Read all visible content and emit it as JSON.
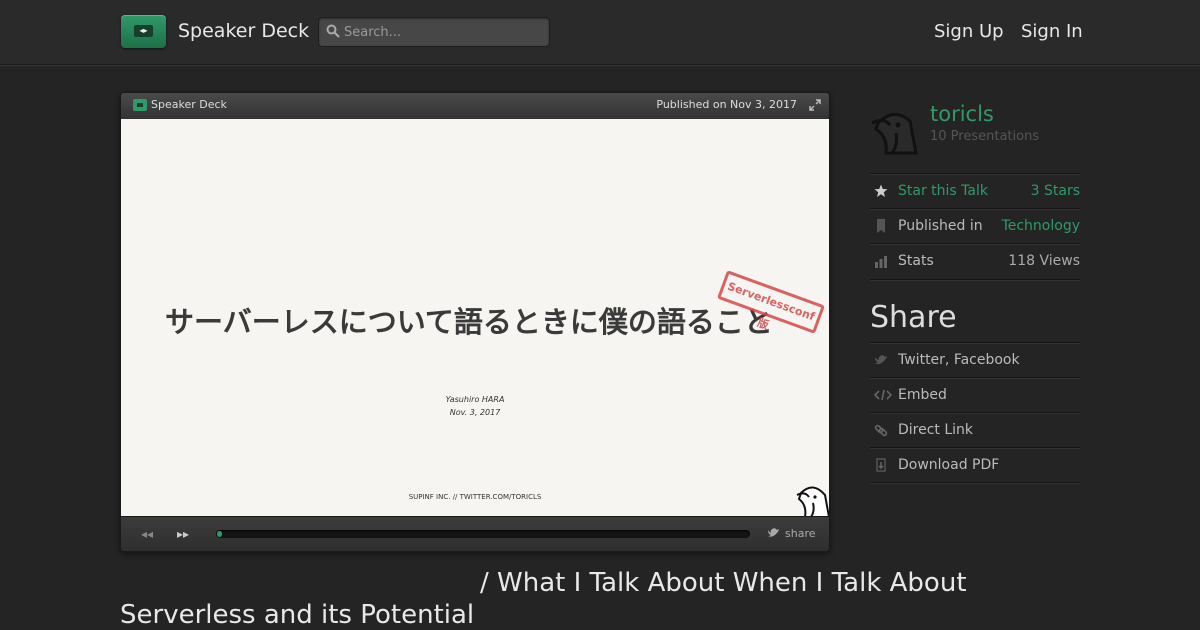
{
  "header": {
    "brand": "Speaker Deck",
    "logo_glyph": "◂▸",
    "search_placeholder": "Search...",
    "sign_up": "Sign Up",
    "sign_in": "Sign In"
  },
  "player": {
    "brand": "Speaker Deck",
    "published": "Published on Nov 3, 2017",
    "slide": {
      "title": "サーバーレスについて語るときに僕の語ること",
      "stamp": "Serverlessconf 版",
      "author": "Yasuhiro HARA",
      "date": "Nov. 3, 2017",
      "footer": "SUPINF INC. // TWITTER.COM/TORICLS"
    },
    "controls": {
      "prev_icon": "◂◂",
      "next_icon": "▸▸",
      "progress": 0.01,
      "share_label": "share"
    }
  },
  "talk_title": "/ What I Talk About When I Talk About Serverless and its Potential",
  "sidebar": {
    "user_name": "toricls",
    "presentations": "10 Presentations",
    "rows": [
      {
        "label": "Star this Talk",
        "value": "3 Stars",
        "icon": "star-icon"
      },
      {
        "label": "Published in",
        "value": "Technology",
        "icon": "bookmark-icon"
      },
      {
        "label": "Stats",
        "value": "118 Views",
        "icon": "bar-chart-icon"
      }
    ],
    "share_heading": "Share",
    "share_items": [
      {
        "label": "Twitter, Facebook",
        "icon": "bird-icon"
      },
      {
        "label": "Embed",
        "icon": "code-icon"
      },
      {
        "label": "Direct Link",
        "icon": "link-icon"
      },
      {
        "label": "Download PDF",
        "icon": "download-icon"
      }
    ]
  },
  "colors": {
    "accent": "#2f9a6a",
    "background": "#242424",
    "stamp": "#d84848"
  }
}
